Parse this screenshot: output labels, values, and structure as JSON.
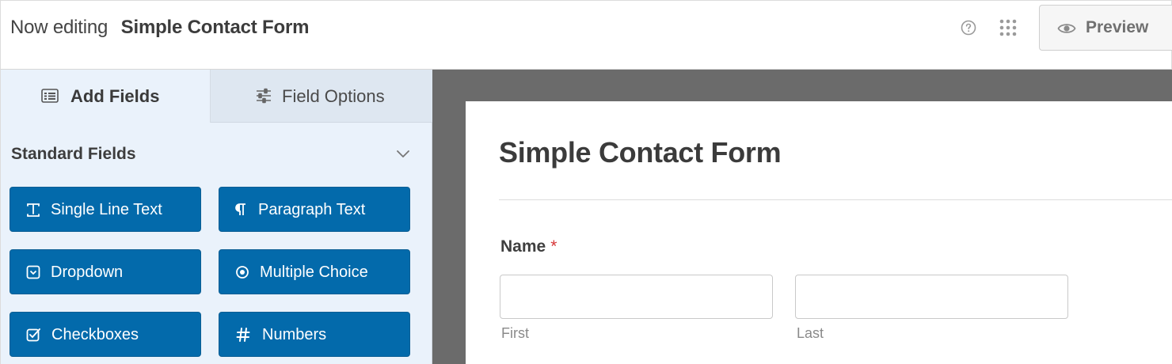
{
  "header": {
    "prefix": "Now editing",
    "form_name": "Simple Contact Form",
    "help_icon": "question-circle-icon",
    "apps_icon": "grid-dots-icon",
    "preview_label": "Preview",
    "preview_icon": "eye-icon"
  },
  "sidebar": {
    "tabs": [
      {
        "label": "Add Fields",
        "icon": "list-icon",
        "active": true
      },
      {
        "label": "Field Options",
        "icon": "sliders-icon",
        "active": false
      }
    ],
    "section_title": "Standard Fields",
    "section_toggle_icon": "chevron-down-icon",
    "fields": [
      {
        "label": "Single Line Text",
        "icon": "text-cursor-icon"
      },
      {
        "label": "Paragraph Text",
        "icon": "pilcrow-icon"
      },
      {
        "label": "Dropdown",
        "icon": "dropdown-icon"
      },
      {
        "label": "Multiple Choice",
        "icon": "radio-icon"
      },
      {
        "label": "Checkboxes",
        "icon": "checkbox-icon"
      },
      {
        "label": "Numbers",
        "icon": "hash-icon"
      }
    ]
  },
  "form": {
    "title": "Simple Contact Form",
    "name_field": {
      "label": "Name",
      "required_mark": "*",
      "first_sublabel": "First",
      "last_sublabel": "Last"
    }
  },
  "colors": {
    "accent": "#036aab",
    "sidebar_bg": "#eaf2fb",
    "canvas_bg": "#6b6b6b",
    "required": "#d63638"
  }
}
